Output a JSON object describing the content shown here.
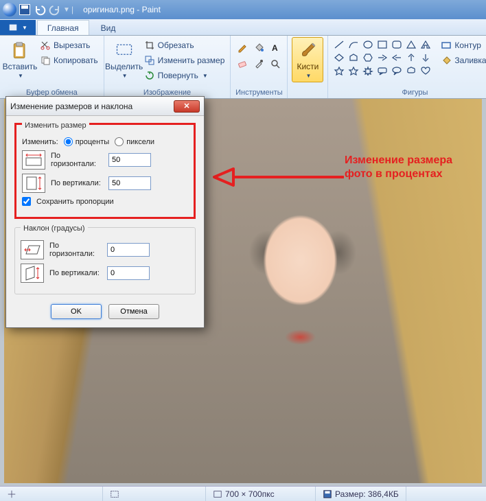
{
  "window": {
    "title": "оригинал.png - Paint"
  },
  "tabs": {
    "home": "Главная",
    "view": "Вид"
  },
  "ribbon": {
    "clipboard": {
      "paste": "Вставить",
      "cut": "Вырезать",
      "copy": "Копировать",
      "group": "Буфер обмена"
    },
    "image": {
      "select": "Выделить",
      "crop": "Обрезать",
      "resize": "Изменить размер",
      "rotate": "Повернуть",
      "group": "Изображение"
    },
    "tools": {
      "group": "Инструменты"
    },
    "brushes": {
      "label": "Кисти"
    },
    "shapes": {
      "outline": "Контур",
      "fill": "Заливка",
      "group": "Фигуры"
    }
  },
  "dialog": {
    "title": "Изменение размеров и наклона",
    "resize_legend": "Изменить размер",
    "by_label": "Изменить:",
    "percent_label": "проценты",
    "pixels_label": "пиксели",
    "horiz_label": "По горизонтали:",
    "vert_label": "По вертикали:",
    "horiz_value": "50",
    "vert_value": "50",
    "aspect_label": "Сохранить пропорции",
    "skew_legend": "Наклон (градусы)",
    "skew_h_value": "0",
    "skew_v_value": "0",
    "ok": "OK",
    "cancel": "Отмена"
  },
  "annotation": {
    "text": "Изменение размера фото в процентах"
  },
  "status": {
    "dims": "700 × 700пкс",
    "size": "Размер: 386,4КБ"
  }
}
